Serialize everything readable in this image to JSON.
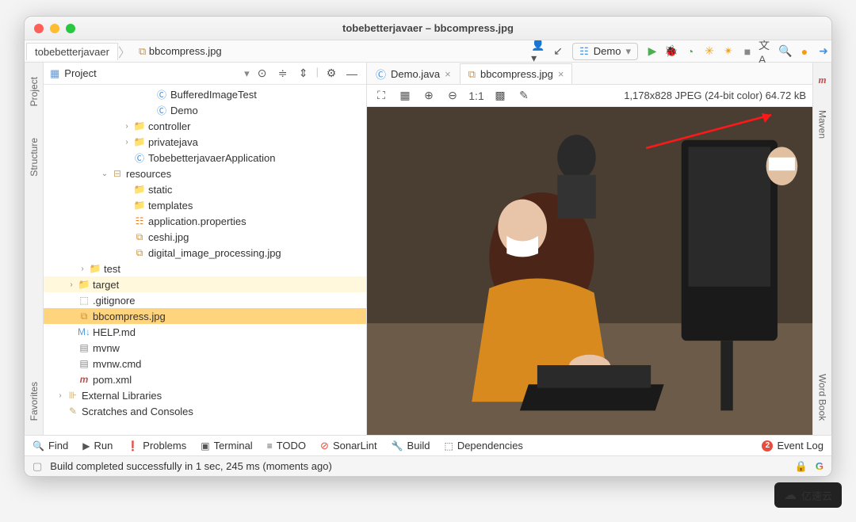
{
  "window": {
    "title": "tobebetterjavaer – bbcompress.jpg"
  },
  "breadcrumb": {
    "root": "tobebetterjavaer",
    "file": "bbcompress.jpg"
  },
  "run_config": {
    "label": "Demo"
  },
  "project_pane": {
    "title": "Project"
  },
  "tree": [
    {
      "indent": 9,
      "caret": "",
      "icon": "class",
      "label": "BufferedImageTest"
    },
    {
      "indent": 9,
      "caret": "",
      "icon": "class",
      "label": "Demo"
    },
    {
      "indent": 7,
      "caret": "›",
      "icon": "folder",
      "label": "controller"
    },
    {
      "indent": 7,
      "caret": "›",
      "icon": "folder",
      "label": "privatejava"
    },
    {
      "indent": 7,
      "caret": "",
      "icon": "class",
      "label": "TobebetterjavaerApplication"
    },
    {
      "indent": 5,
      "caret": "⌄",
      "icon": "res",
      "label": "resources"
    },
    {
      "indent": 7,
      "caret": "",
      "icon": "folder",
      "label": "static"
    },
    {
      "indent": 7,
      "caret": "",
      "icon": "folder",
      "label": "templates"
    },
    {
      "indent": 7,
      "caret": "",
      "icon": "props",
      "label": "application.properties"
    },
    {
      "indent": 7,
      "caret": "",
      "icon": "img",
      "label": "ceshi.jpg"
    },
    {
      "indent": 7,
      "caret": "",
      "icon": "img",
      "label": "digital_image_processing.jpg"
    },
    {
      "indent": 3,
      "caret": "›",
      "icon": "folder",
      "label": "test"
    },
    {
      "indent": 2,
      "caret": "›",
      "icon": "target",
      "label": "target",
      "hl": true
    },
    {
      "indent": 2,
      "caret": "",
      "icon": "git",
      "label": ".gitignore"
    },
    {
      "indent": 2,
      "caret": "",
      "icon": "img",
      "label": "bbcompress.jpg",
      "sel": true
    },
    {
      "indent": 2,
      "caret": "",
      "icon": "md",
      "label": "HELP.md"
    },
    {
      "indent": 2,
      "caret": "",
      "icon": "sh",
      "label": "mvnw"
    },
    {
      "indent": 2,
      "caret": "",
      "icon": "sh",
      "label": "mvnw.cmd"
    },
    {
      "indent": 2,
      "caret": "",
      "icon": "mvn",
      "label": "pom.xml"
    },
    {
      "indent": 1,
      "caret": "›",
      "icon": "lib",
      "label": "External Libraries"
    },
    {
      "indent": 1,
      "caret": "",
      "icon": "scratch",
      "label": "Scratches and Consoles"
    }
  ],
  "tabs": [
    {
      "label": "Demo.java",
      "active": false
    },
    {
      "label": "bbcompress.jpg",
      "active": true
    }
  ],
  "image_info": "1,178x828 JPEG (24-bit color) 64.72 kB",
  "left_tabs": [
    "Project",
    "Structure",
    "Favorites"
  ],
  "right_tabs": [
    "Maven",
    "Word Book"
  ],
  "bottom_tools": [
    {
      "icon": "🔍",
      "label": "Find"
    },
    {
      "icon": "▶",
      "label": "Run"
    },
    {
      "icon": "❗",
      "label": "Problems"
    },
    {
      "icon": "▣",
      "label": "Terminal"
    },
    {
      "icon": "≡",
      "label": "TODO"
    },
    {
      "icon": "⊘",
      "label": "SonarLint"
    },
    {
      "icon": "🔧",
      "label": "Build"
    },
    {
      "icon": "⬚",
      "label": "Dependencies"
    }
  ],
  "event_log": {
    "count": "2",
    "label": "Event Log"
  },
  "status_msg": "Build completed successfully in 1 sec, 245 ms (moments ago)",
  "watermark": "亿速云"
}
